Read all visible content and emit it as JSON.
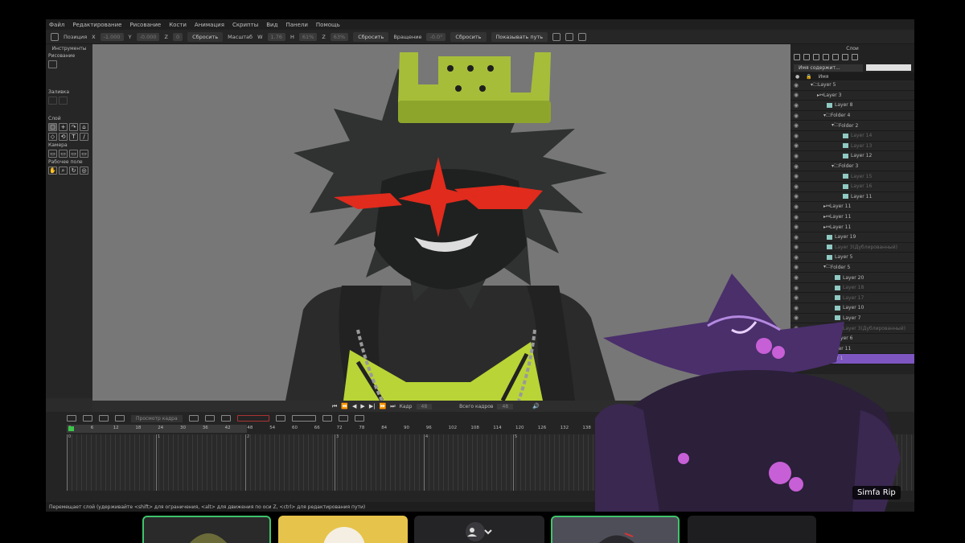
{
  "menu": [
    "Файл",
    "Редактирование",
    "Рисование",
    "Кости",
    "Анимация",
    "Скрипты",
    "Вид",
    "Панели",
    "Помощь"
  ],
  "toolbar": {
    "position_label": "Позиция",
    "x_label": "X",
    "x_value": "-1.000",
    "y_label": "Y",
    "y_value": "-0.000",
    "z_label": "Z",
    "z_value": "0",
    "reset1": "Сбросить",
    "scale_label": "Масштаб",
    "w_label": "W",
    "w_value": "1.76",
    "h_label": "H",
    "h_value": "61%",
    "hz_label": "Z",
    "hz_value": "63%",
    "reset2": "Сбросить",
    "rotation_label": "Вращение",
    "rotation_value": "-0.0°",
    "reset3": "Сбросить",
    "show_path": "Показывать путь"
  },
  "tools": {
    "title": "Инструменты",
    "drawing": "Рисование",
    "fill": "Заливка",
    "layer": "Слой",
    "camera": "Камера",
    "workspace": "Рабочее поле"
  },
  "layers": {
    "title": "Слои",
    "filter": "Имя содержит...",
    "col_name": "Имя",
    "items": [
      {
        "label": "Layer 5",
        "indent": 4,
        "type": "folder"
      },
      {
        "label": "Layer 3",
        "indent": 12,
        "type": "bone"
      },
      {
        "label": "Layer 8",
        "indent": 24,
        "type": "img"
      },
      {
        "label": "Folder 4",
        "indent": 20,
        "type": "folder"
      },
      {
        "label": "Folder 2",
        "indent": 30,
        "type": "folder"
      },
      {
        "label": "Layer 14",
        "indent": 44,
        "type": "img",
        "dim": true
      },
      {
        "label": "Layer 13",
        "indent": 44,
        "type": "img",
        "dim": true
      },
      {
        "label": "Layer 12",
        "indent": 44,
        "type": "img"
      },
      {
        "label": "Folder 3",
        "indent": 30,
        "type": "folder"
      },
      {
        "label": "Layer 15",
        "indent": 44,
        "type": "img",
        "dim": true
      },
      {
        "label": "Layer 16",
        "indent": 44,
        "type": "img",
        "dim": true
      },
      {
        "label": "Layer 11",
        "indent": 44,
        "type": "img"
      },
      {
        "label": "Layer 11",
        "indent": 20,
        "type": "bone"
      },
      {
        "label": "Layer 11",
        "indent": 20,
        "type": "bone"
      },
      {
        "label": "Layer 11",
        "indent": 20,
        "type": "bone"
      },
      {
        "label": "Layer 19",
        "indent": 24,
        "type": "img"
      },
      {
        "label": "Layer 3(Дублированный)",
        "indent": 24,
        "type": "img",
        "dim": true
      },
      {
        "label": "Layer 5",
        "indent": 24,
        "type": "img"
      },
      {
        "label": "Folder 5",
        "indent": 20,
        "type": "folder"
      },
      {
        "label": "Layer 20",
        "indent": 34,
        "type": "img"
      },
      {
        "label": "Layer 18",
        "indent": 34,
        "type": "img",
        "dim": true
      },
      {
        "label": "Layer 17",
        "indent": 34,
        "type": "img",
        "dim": true
      },
      {
        "label": "Layer 10",
        "indent": 34,
        "type": "img"
      },
      {
        "label": "Layer 7",
        "indent": 34,
        "type": "img"
      },
      {
        "label": "Layer 3(Дублированный)",
        "indent": 34,
        "type": "img",
        "dim": true
      },
      {
        "label": "Layer 6",
        "indent": 24,
        "type": "img"
      },
      {
        "label": "Layer 11",
        "indent": 20,
        "type": "bone"
      },
      {
        "label": "Layer 1",
        "indent": 12,
        "type": "img",
        "selected": true
      }
    ]
  },
  "playback": {
    "frame_label": "Кадр",
    "frame_value": "48",
    "total_label": "Всего кадров",
    "total_value": "48"
  },
  "timeline": {
    "onion_label": "Просмотр кадра",
    "ruler": [
      "0",
      "6",
      "12",
      "18",
      "24",
      "30",
      "36",
      "42",
      "48",
      "54",
      "60",
      "66",
      "72",
      "78",
      "84",
      "90",
      "96",
      "102",
      "108",
      "114",
      "120",
      "126",
      "132",
      "138"
    ],
    "markers": [
      "0",
      "1",
      "2",
      "3",
      "4",
      "5",
      "6"
    ]
  },
  "status": "Перемещает слой (удерживайте <shift> для ограничения, <alt> для движения по оси Z, <ctrl> для редактирования пути)",
  "nametag": "Simfa Rip",
  "colors": {
    "accent": "#7d56c0",
    "keyframe": "#3cc64a",
    "speaking": "#3fc46b"
  }
}
